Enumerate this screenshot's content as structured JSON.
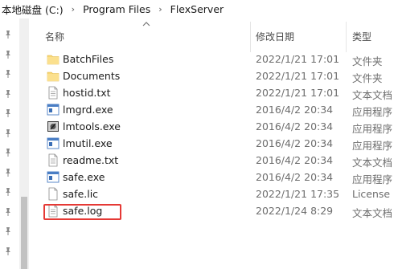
{
  "breadcrumb": {
    "segments": [
      "本地磁盘 (C:)",
      "Program Files",
      "FlexServer"
    ],
    "separator": "›"
  },
  "columns": {
    "name": "名称",
    "modified": "修改日期",
    "type": "类型"
  },
  "files": [
    {
      "name": "BatchFiles",
      "modified": "2022/1/21 17:01",
      "type": "文件夹",
      "icon": "folder-icon"
    },
    {
      "name": "Documents",
      "modified": "2022/1/21 17:01",
      "type": "文件夹",
      "icon": "folder-icon"
    },
    {
      "name": "hostid.txt",
      "modified": "2022/1/21 17:01",
      "type": "文本文档",
      "icon": "text-file-icon"
    },
    {
      "name": "lmgrd.exe",
      "modified": "2016/4/2 20:34",
      "type": "应用程序",
      "icon": "application-icon"
    },
    {
      "name": "lmtools.exe",
      "modified": "2016/4/2 20:34",
      "type": "应用程序",
      "icon": "lmtools-icon"
    },
    {
      "name": "lmutil.exe",
      "modified": "2016/4/2 20:34",
      "type": "应用程序",
      "icon": "application-icon"
    },
    {
      "name": "readme.txt",
      "modified": "2016/4/2 20:34",
      "type": "文本文档",
      "icon": "text-file-icon"
    },
    {
      "name": "safe.exe",
      "modified": "2016/4/2 20:34",
      "type": "应用程序",
      "icon": "application-icon"
    },
    {
      "name": "safe.lic",
      "modified": "2022/1/21 17:35",
      "type": "License",
      "icon": "blank-file-icon"
    },
    {
      "name": "safe.log",
      "modified": "2022/1/24 8:29",
      "type": "文本文档",
      "icon": "text-file-icon"
    }
  ],
  "nav_pins": [
    "pin-icon",
    "pin-icon",
    "pin-icon",
    "pin-icon",
    "pin-icon",
    "pin-icon",
    "pin-icon",
    "pin-icon",
    "pin-icon",
    "pin-icon",
    "pin-icon",
    "pin-icon"
  ],
  "highlight_color": "#e53935",
  "folder_color": "#f8d775"
}
